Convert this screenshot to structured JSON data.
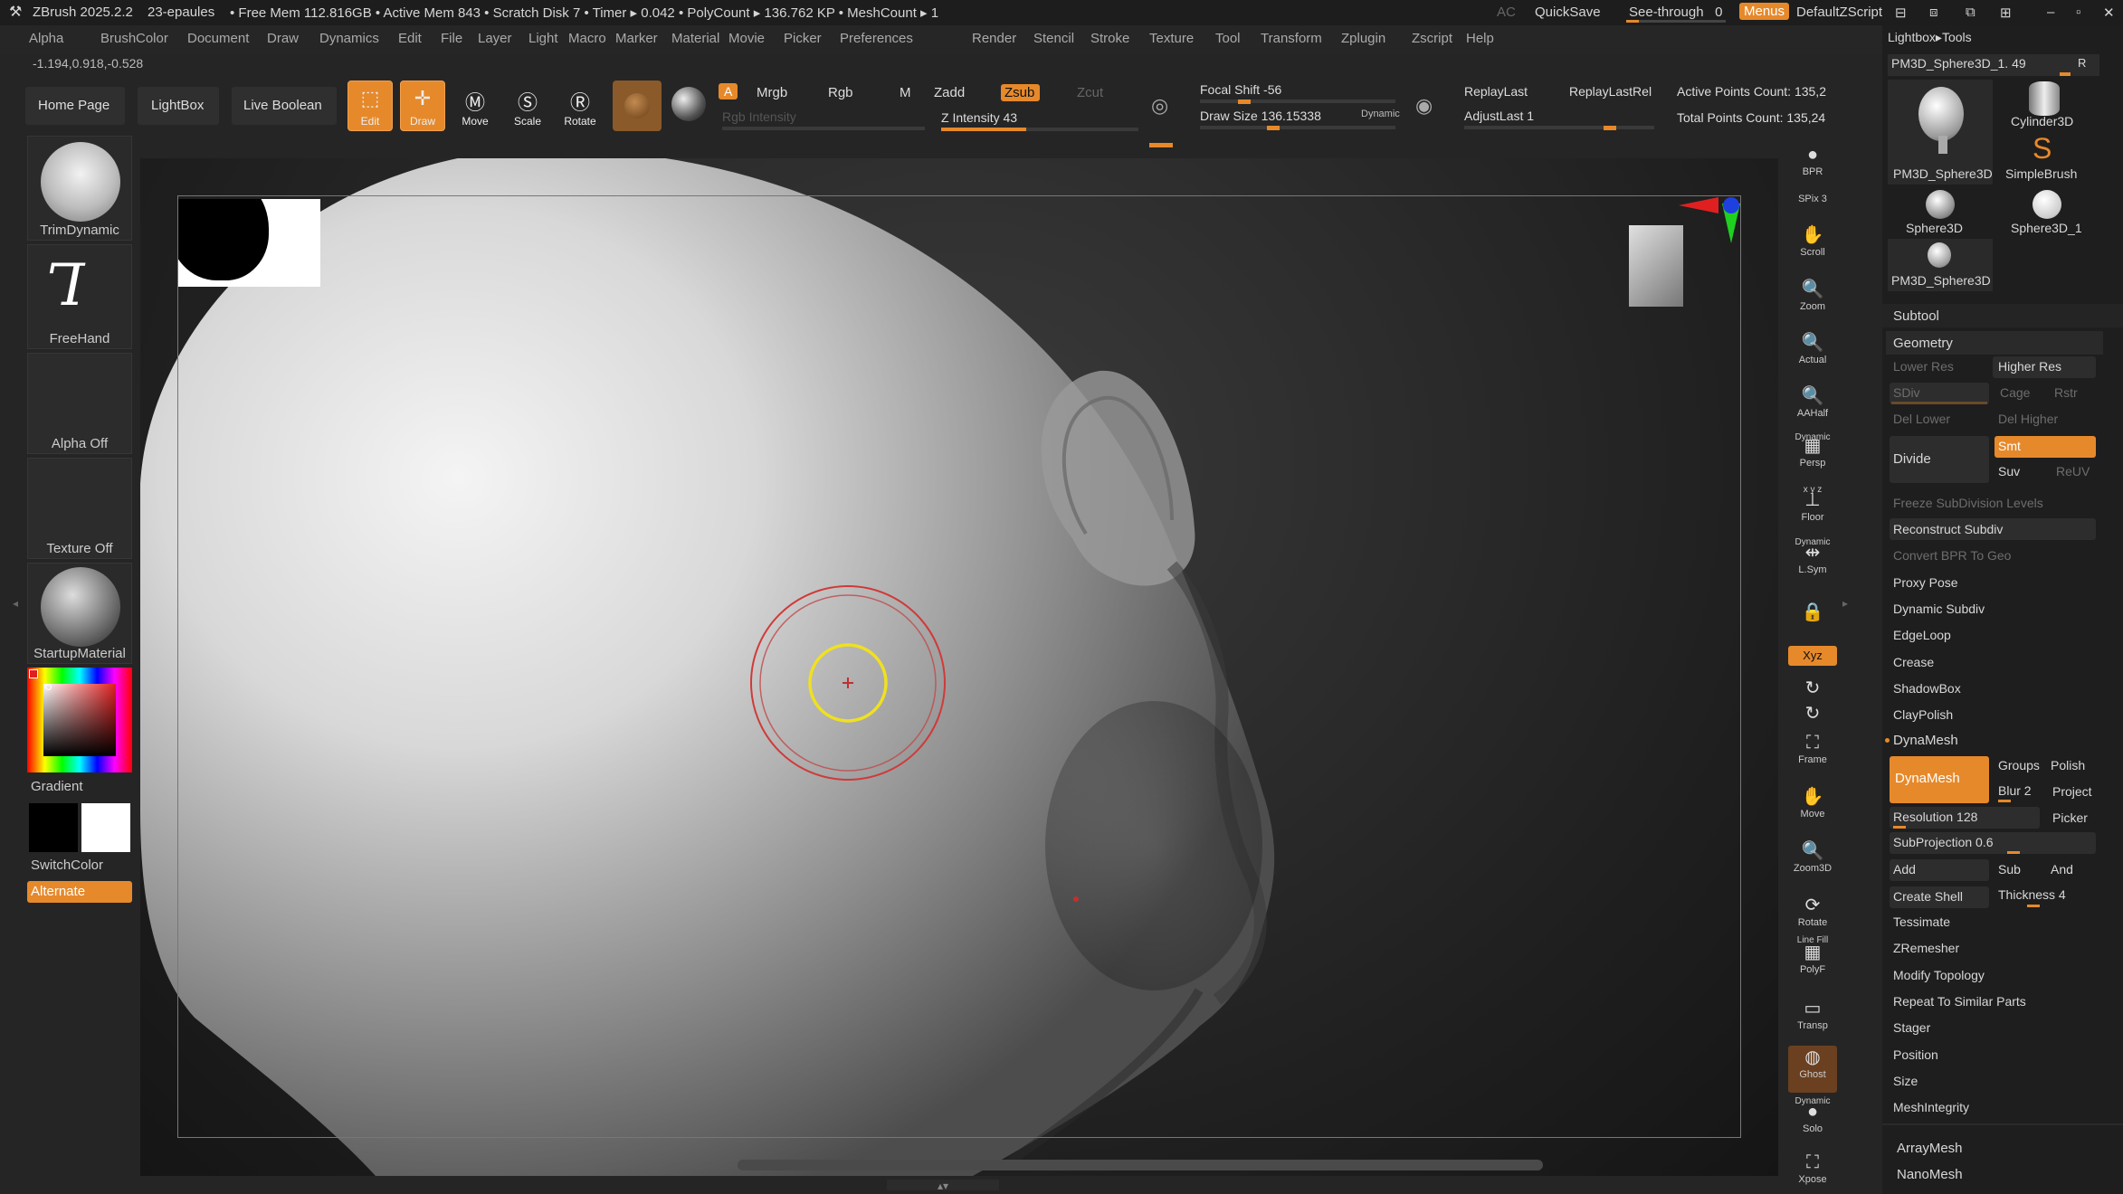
{
  "titlebar": {
    "app": "ZBrush 2025.2.2",
    "doc": "23-epaules",
    "status": "• Free Mem 112.816GB • Active Mem 843 • Scratch Disk 7 • Timer ▸ 0.042 • PolyCount ▸ 136.762 KP • MeshCount ▸ 1",
    "ac": "AC",
    "quicksave": "QuickSave",
    "seethrough": "See-through",
    "seethrough_value": "0",
    "menus": "Menus",
    "script": "DefaultZScript"
  },
  "menubar": [
    "Alpha",
    "Brush",
    "Color",
    "Document",
    "Draw",
    "Dynamics",
    "Edit",
    "File",
    "Layer",
    "Light",
    "Macro",
    "Marker",
    "Material",
    "Movie",
    "Picker",
    "Preferences",
    "Render",
    "Stencil",
    "Stroke",
    "Texture",
    "Tool",
    "Transform",
    "Zplugin",
    "Zscript",
    "Help"
  ],
  "coords": "-1.194,0.918,-0.528",
  "toolbar": {
    "home": "Home Page",
    "lightbox": "LightBox",
    "liveboolean": "Live Boolean",
    "edit": "Edit",
    "draw": "Draw",
    "move": "Move",
    "scale": "Scale",
    "rotate": "Rotate",
    "a": "A",
    "mrgb": "Mrgb",
    "rgb": "Rgb",
    "m": "M",
    "zadd": "Zadd",
    "zsub": "Zsub",
    "zcut": "Zcut",
    "rgb_intensity": "Rgb Intensity",
    "z_intensity": "Z Intensity 43",
    "z_intensity_value": 43,
    "focal_shift": "Focal Shift -56",
    "draw_size": "Draw Size 136.15338",
    "dynamic": "Dynamic",
    "replay_last": "ReplayLast",
    "replay_last_rel": "ReplayLastRel",
    "adjust_last": "AdjustLast 1",
    "active_points": "Active Points Count: 135,2",
    "total_points": "Total Points Count: 135,24"
  },
  "leftshelf": {
    "brush1": "TrimDynamic",
    "brush2": "FreeHand",
    "alpha": "Alpha Off",
    "texture": "Texture Off",
    "material": "StartupMaterial",
    "gradient": "Gradient",
    "switchcolor": "SwitchColor",
    "alternate": "Alternate"
  },
  "rightshelf": [
    "BPR",
    "SPix 3",
    "Scroll",
    "Zoom",
    "Actual",
    "AAHalf",
    "Persp",
    "Floor",
    "L.Sym",
    "",
    "Xyz",
    "",
    "",
    "Frame",
    "Move",
    "Zoom3D",
    "Rotate",
    "PolyF",
    "Transp",
    "Ghost",
    "Solo",
    "Xpose"
  ],
  "rightshelf_extra": {
    "dynamic1": "Dynamic",
    "dynamic2": "Dynamic",
    "dynamic3": "Dynamic",
    "linefill": "Line Fill",
    "xyz_letters": "x y z"
  },
  "tool": {
    "header": "Lightbox▸Tools",
    "current": "PM3D_Sphere3D_1. 49",
    "r": "R",
    "thumbs": [
      "PM3D_Sphere3D",
      "Cylinder3D",
      "SimpleBrush",
      "Sphere3D",
      "Sphere3D_1",
      "PM3D_Sphere3D"
    ]
  },
  "subtool": "Subtool",
  "geometry": {
    "title": "Geometry",
    "lower_res": "Lower Res",
    "higher_res": "Higher Res",
    "sdiv": "SDiv",
    "cage": "Cage",
    "rstr": "Rstr",
    "del_lower": "Del Lower",
    "del_higher": "Del Higher",
    "divide": "Divide",
    "smt": "Smt",
    "suv": "Suv",
    "reuv": "ReUV",
    "items": [
      "Freeze SubDivision Levels",
      "Reconstruct Subdiv",
      "Convert BPR To Geo",
      "Proxy Pose",
      "Dynamic Subdiv",
      "EdgeLoop",
      "Crease",
      "ShadowBox",
      "ClayPolish"
    ]
  },
  "dynamesh": {
    "title": "DynaMesh",
    "button": "DynaMesh",
    "groups": "Groups",
    "polish": "Polish",
    "blur": "Blur 2",
    "project": "Project",
    "resolution": "Resolution 128",
    "picker": "Picker",
    "subprojection": "SubProjection 0.6",
    "add": "Add",
    "sub": "Sub",
    "and": "And",
    "create_shell": "Create Shell",
    "thickness": "Thickness 4"
  },
  "geo_more": [
    "Tessimate",
    "ZRemesher",
    "Modify Topology",
    "Repeat To Similar Parts",
    "Stager",
    "Position",
    "Size",
    "MeshIntegrity"
  ],
  "bottom": [
    "ArrayMesh",
    "NanoMesh"
  ],
  "colors": {
    "accent": "#e6892b",
    "bg": "#252525",
    "panel": "#1e1e1e"
  }
}
